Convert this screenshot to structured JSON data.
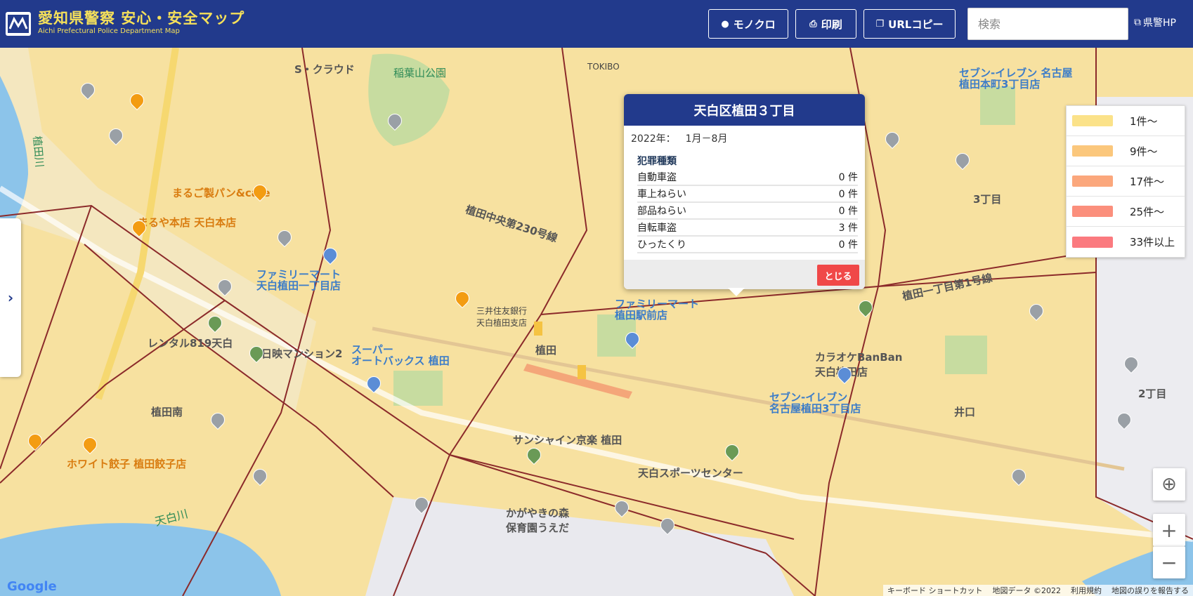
{
  "header": {
    "title": "愛知県警察 安心・安全マップ",
    "subtitle": "Aichi Prefectural Police Department Map",
    "buttons": {
      "mono": "モノクロ",
      "print": "印刷",
      "url_copy": "URLコピー"
    },
    "search_placeholder": "検索",
    "kenkei_link": "県警HP",
    "colors": {
      "bar": "#223a8c",
      "title": "#f5e05a"
    }
  },
  "legend": [
    {
      "label": "1件～",
      "color": "#fbe289"
    },
    {
      "label": "9件～",
      "color": "#fbc77c"
    },
    {
      "label": "17件～",
      "color": "#fba77c"
    },
    {
      "label": "25件～",
      "color": "#fb8f7c"
    },
    {
      "label": "33件以上",
      "color": "#fb7a7f"
    }
  ],
  "popup": {
    "title": "天白区植田３丁目",
    "year": "2022年：",
    "months": "1月－8月",
    "section_title": "犯罪種類",
    "rows": [
      {
        "name": "自動車盗",
        "count": "0 件"
      },
      {
        "name": "車上ねらい",
        "count": "0 件"
      },
      {
        "name": "部品ねらい",
        "count": "0 件"
      },
      {
        "name": "自転車盗",
        "count": "3 件"
      },
      {
        "name": "ひったくり",
        "count": "0 件"
      }
    ],
    "close_label": "とじる"
  },
  "map": {
    "sidebar_toggle": "›",
    "zoom_in": "+",
    "zoom_out": "−",
    "locate": "⊕",
    "google": "Google",
    "attribution": [
      "キーボード ショートカット",
      "地図データ ©2022",
      "利用規約",
      "地図の誤りを報告する"
    ],
    "labels": {
      "inaba_park": "稲葉山公園",
      "ueda_river": "植田川",
      "tenpaku_river": "天白川",
      "ueda_station": "植田",
      "familymart1": "ファミリーマート\n植田駅前店",
      "familymart2": "ファミリーマート\n天白植田一丁目店",
      "seven1": "セブン-イレブン\n名古屋植田3丁目店",
      "seven2": "セブン-イレブン 名古屋\n植田本町3丁目店",
      "supermarket": "スーパー\nオートバックス 植田",
      "maruko": "まるご製パン&cafe",
      "maruya": "まるや本店 天白本店",
      "white_gyoza": "ホワイト餃子 植田餃子店",
      "karaoke": "カラオケBanBan\n天白植田店",
      "sports": "天白スポーツセンター",
      "ueda_minami": "植田南",
      "iguchi": "井口",
      "ueda_chuo_230": "植田中央第230号線",
      "nakamura": "天白植田一丁目",
      "s_cloud": "S・クラウド",
      "kagaya": "かがやきの森\n保育園うえだ",
      "rental": "レンタル819天白",
      "sanshine": "サンシャイン京楽 植田",
      "ueda_1_1": "植田一丁目第1号線",
      "sanyo": "三井住友銀行\n天白植田支店",
      "tokibo": "TOKIBO",
      "nichiei": "日映マンション2",
      "cho3": "3丁目",
      "cho2": "2丁目"
    }
  }
}
